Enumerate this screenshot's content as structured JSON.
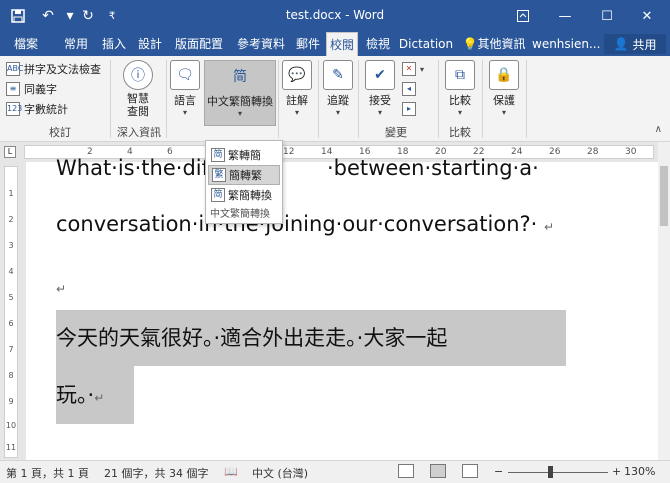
{
  "titlebar": {
    "title": "test.docx - Word",
    "save_icon": "save-icon",
    "undo_icon": "undo-icon",
    "redo_icon": "redo-icon",
    "customize_icon": "chevron-down-icon",
    "ribbon_options_icon": "ribbon-display-icon",
    "minimize": "—",
    "maximize": "☐",
    "close": "✕"
  },
  "tabs": [
    {
      "label": "檔案"
    },
    {
      "label": "常用"
    },
    {
      "label": "插入"
    },
    {
      "label": "設計"
    },
    {
      "label": "版面配置"
    },
    {
      "label": "參考資料"
    },
    {
      "label": "郵件"
    },
    {
      "label": "校閱"
    },
    {
      "label": "檢視"
    },
    {
      "label": "Dictation"
    }
  ],
  "tellme": "其他資訊",
  "user": "wenhsien...",
  "share": "共用",
  "ribbon": {
    "proofing": {
      "spell": "拼字及文法檢查",
      "thesaurus": "同義字",
      "wordcount": "字數統計",
      "group": "校訂"
    },
    "insights": {
      "smart_lookup": "智慧\n查閱",
      "group": "深入資訊"
    },
    "language": {
      "label": "語言"
    },
    "chinese": {
      "label": "中文繁簡轉換"
    },
    "comments": {
      "label": "註解"
    },
    "tracking": {
      "label": "追蹤"
    },
    "changes": {
      "accept": "接受",
      "group": "變更"
    },
    "compare": {
      "label": "比較",
      "group": "比較"
    },
    "protect": {
      "label": "保護"
    }
  },
  "dropdown": {
    "items": [
      {
        "label": "繁轉簡"
      },
      {
        "label": "簡轉繁"
      },
      {
        "label": "繁簡轉換"
      }
    ],
    "footer": "中文繁簡轉換"
  },
  "document": {
    "line1": "What·is·the·dif",
    "line1b": "·between·starting·a·",
    "line2": "conversation·in·the·joining·our·conversation?·",
    "para_mark": "↵",
    "line3": "今天的天氣很好。·適合外出走走。·大家一起",
    "line4": "玩。·"
  },
  "ruler_numbers": [
    "2",
    "4",
    "6",
    "8",
    "10",
    "12",
    "14",
    "16",
    "18",
    "20",
    "22",
    "24",
    "26",
    "28",
    "30"
  ],
  "vruler_numbers": [
    "1",
    "2",
    "3",
    "4",
    "5",
    "6",
    "7",
    "8",
    "9",
    "10",
    "11"
  ],
  "status": {
    "page": "第 1 頁，共 1 頁",
    "words": "21 個字，共 34 個字",
    "language": "中文 (台灣)",
    "zoom": "130%",
    "zoom_minus": "−",
    "zoom_plus": "+"
  }
}
